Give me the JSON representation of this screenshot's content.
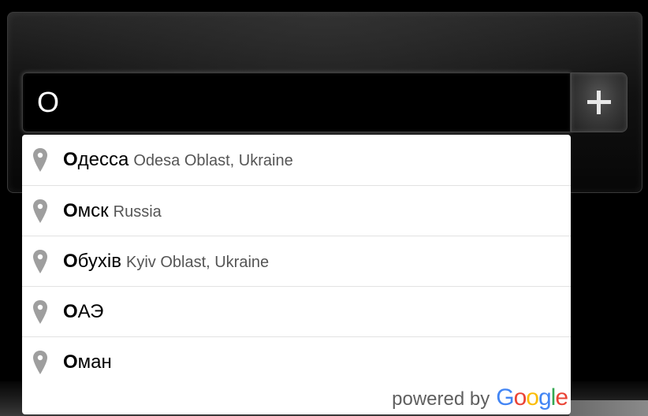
{
  "search": {
    "value": "О"
  },
  "add_button": {
    "icon": "plus-icon"
  },
  "suggestions": [
    {
      "match": "О",
      "rest": "десса",
      "secondary": "Odesa Oblast, Ukraine"
    },
    {
      "match": "О",
      "rest": "мск",
      "secondary": "Russia"
    },
    {
      "match": "О",
      "rest": "бухів",
      "secondary": "Kyiv Oblast, Ukraine"
    },
    {
      "match": "О",
      "rest": "АЭ",
      "secondary": ""
    },
    {
      "match": "О",
      "rest": "ман",
      "secondary": ""
    }
  ],
  "attribution": {
    "powered_by": "powered by",
    "logo_letters": [
      "G",
      "o",
      "o",
      "g",
      "l",
      "e"
    ]
  },
  "colors": {
    "background": "#000000",
    "pin_gray": "#9e9e9e",
    "google_blue": "#4285F4",
    "google_red": "#EA4335",
    "google_yellow": "#FBBC05",
    "google_green": "#34A853"
  }
}
